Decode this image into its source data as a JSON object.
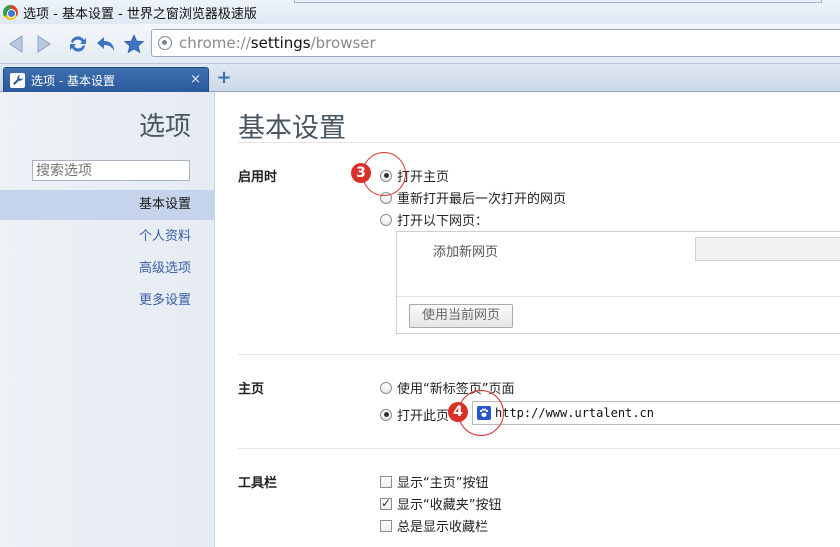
{
  "window": {
    "title": "选项 - 基本设置 - 世界之窗浏览器极速版"
  },
  "toolbar": {
    "url_scheme": "chrome://",
    "url_host": "settings",
    "url_path": "/browser"
  },
  "tabs": [
    {
      "label": "选项 - 基本设置",
      "close": "×"
    }
  ],
  "new_tab": "+",
  "sidebar": {
    "title": "选项",
    "search_placeholder": "搜索选项",
    "items": [
      {
        "label": "基本设置",
        "active": true
      },
      {
        "label": "个人资料",
        "active": false
      },
      {
        "label": "高级选项",
        "active": false
      },
      {
        "label": "更多设置",
        "active": false
      }
    ]
  },
  "main": {
    "title": "基本设置",
    "startup": {
      "label": "启用时",
      "options": [
        "打开主页",
        "重新打开最后一次打开的网页",
        "打开以下网页："
      ],
      "selected": 0,
      "add_page": "添加新网页",
      "use_current_button": "使用当前网页"
    },
    "homepage": {
      "label": "主页",
      "options": [
        "使用“新标签页”页面",
        "打开此页："
      ],
      "selected": 1,
      "url": "http://www.urtalent.cn"
    },
    "toolbar_section": {
      "label": "工具栏",
      "options": [
        {
          "label": "显示“主页”按钮",
          "checked": false
        },
        {
          "label": "显示“收藏夹”按钮",
          "checked": true
        },
        {
          "label": "总是显示收藏栏",
          "checked": false
        }
      ]
    }
  },
  "annotations": {
    "marker_3": "3",
    "marker_4": "4"
  },
  "colors": {
    "accent": "#3a5fa8",
    "tab_active": "#2b5a9c",
    "marker": "#d9302a",
    "sidebar_active": "#c5d4ea"
  }
}
